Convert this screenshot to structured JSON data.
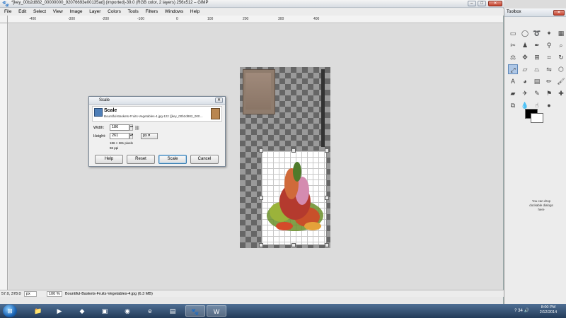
{
  "window": {
    "title": "*[key_00b2d882_00000000_92076693e00135ad] (imported)-39.0 (RGB color, 2 layers) 256x512 – GIMP",
    "min": "–",
    "max": "□",
    "close": "✕"
  },
  "menu": [
    "File",
    "Edit",
    "Select",
    "View",
    "Image",
    "Layer",
    "Colors",
    "Tools",
    "Filters",
    "Windows",
    "Help"
  ],
  "ruler_top": [
    "-400",
    "-300",
    "-200",
    "-100",
    "0",
    "100",
    "200",
    "300",
    "400"
  ],
  "status": {
    "coords": "57.0, 378.0",
    "unit": "px",
    "zoom": "100 %",
    "file": "Bountiful-Baskets-Fruits-Vegetables-4.jpg (6.3 MB)"
  },
  "dialog": {
    "title": "Scale",
    "heading": "Scale",
    "subtitle": "Bountiful-Baskets-Fruits-Vegetables-4.jpg-122 ([key_00b2d882_000…",
    "width_label": "Width:",
    "width_value": "186",
    "height_label": "Height:",
    "height_value": "261",
    "unit": "px",
    "size_text": "186 × 261 pixels",
    "ppi_text": "96 ppi",
    "buttons": {
      "help": "Help",
      "reset": "Reset",
      "scale": "Scale",
      "cancel": "Cancel"
    }
  },
  "toolbox": {
    "title": "Toolbox",
    "drop_hint": "You can drop dockable dialogs here"
  },
  "taskbar": {
    "tray_count": "34",
    "time": "8:00 PM",
    "date": "2/12/2014"
  },
  "colors": {
    "accent": "#3c7fb1",
    "fg": "#000000",
    "bg": "#ffffff"
  }
}
